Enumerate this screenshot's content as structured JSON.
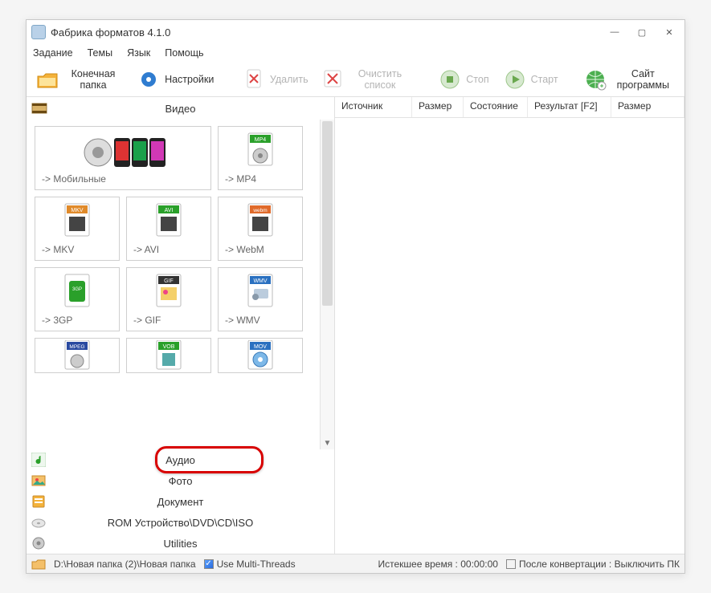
{
  "window": {
    "title": "Фабрика форматов 4.1.0"
  },
  "menu": {
    "task": "Задание",
    "themes": "Темы",
    "lang": "Язык",
    "help": "Помощь"
  },
  "toolbar": {
    "target_folder": "Конечная папка",
    "settings": "Настройки",
    "remove": "Удалить",
    "clear_list": "Очистить список",
    "stop": "Стоп",
    "start": "Старт",
    "site": "Сайт программы"
  },
  "categories": {
    "video": "Видео",
    "audio": "Аудио",
    "photo": "Фото",
    "document": "Документ",
    "rom": "ROM Устройство\\DVD\\CD\\ISO",
    "utilities": "Utilities"
  },
  "tiles": {
    "mobile": "-> Мобильные",
    "mp4": "-> MP4",
    "mkv": "-> MKV",
    "avi": "-> AVI",
    "webm": "-> WebM",
    "3gp": "-> 3GP",
    "gif": "-> GIF",
    "wmv": "-> WMV",
    "mpeg": "MPEG",
    "vob": "VOB",
    "mov": "MOV"
  },
  "columns": {
    "source": "Источник",
    "size": "Размер",
    "state": "Состояние",
    "result": "Результат [F2]",
    "size2": "Размер"
  },
  "status": {
    "path": "D:\\Новая папка (2)\\Новая папка",
    "multithreads": "Use Multi-Threads",
    "elapsed_label": "Истекшее время",
    "elapsed_value": "00:00:00",
    "after_label": "После конвертации",
    "after_value": "Выключить ПК"
  }
}
